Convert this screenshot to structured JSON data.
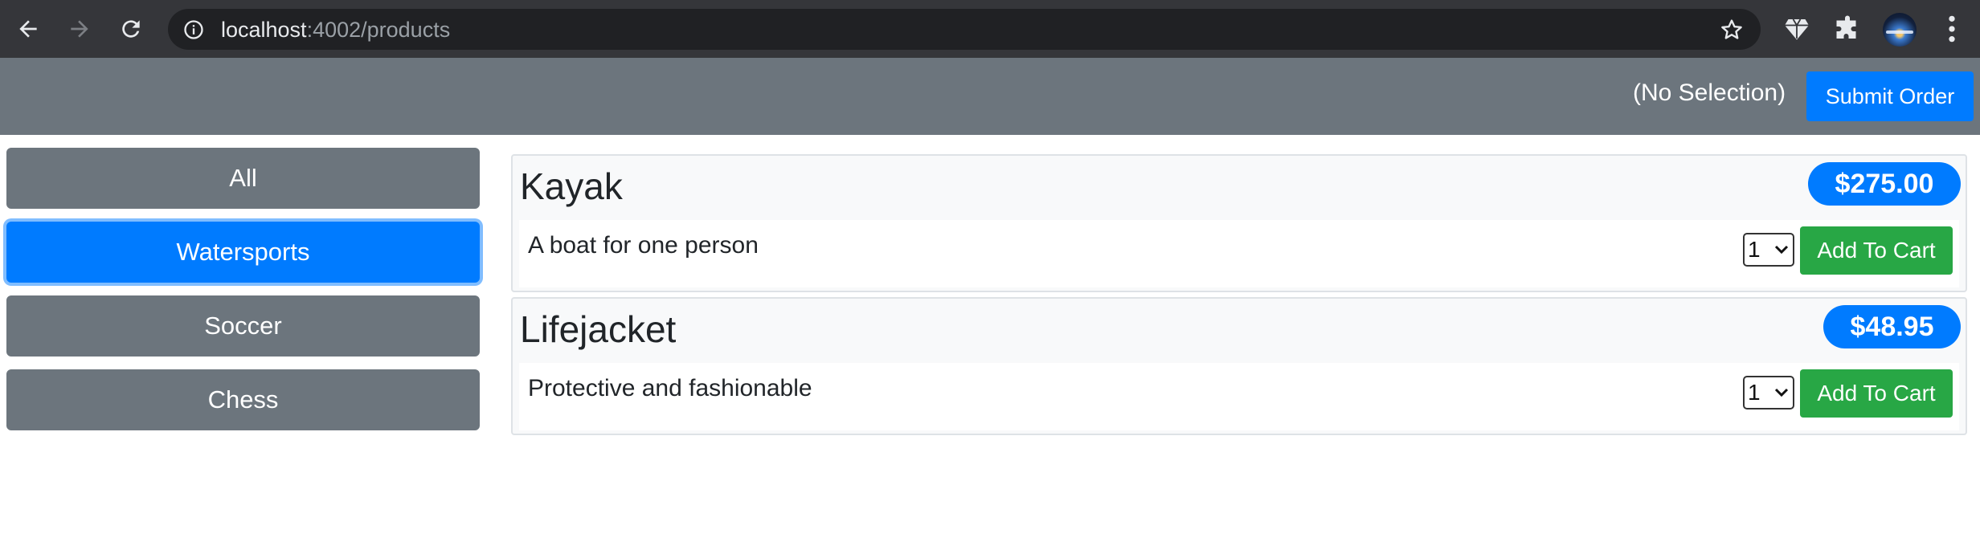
{
  "browser": {
    "url_host": "localhost",
    "url_path": ":4002/products",
    "icons": [
      "back-arrow-icon",
      "forward-arrow-icon",
      "reload-icon",
      "info-icon",
      "star-icon",
      "gem-extension-icon",
      "puzzle-extensions-icon",
      "profile-avatar",
      "kebab-menu-icon"
    ]
  },
  "header": {
    "selection_text": "(No Selection)",
    "submit_label": "Submit Order"
  },
  "categories": [
    {
      "label": "All",
      "active": false
    },
    {
      "label": "Watersports",
      "active": true
    },
    {
      "label": "Soccer",
      "active": false
    },
    {
      "label": "Chess",
      "active": false
    }
  ],
  "products": [
    {
      "name": "Kayak",
      "price": "$275.00",
      "description": "A boat for one person",
      "quantity": "1",
      "add_label": "Add To Cart"
    },
    {
      "name": "Lifejacket",
      "price": "$48.95",
      "description": "Protective and fashionable",
      "quantity": "1",
      "add_label": "Add To Cart"
    }
  ],
  "colors": {
    "primary": "#007bff",
    "secondary": "#6c757d",
    "success": "#28a745",
    "chrome_bg": "#35363a",
    "omnibox_bg": "#202124"
  }
}
